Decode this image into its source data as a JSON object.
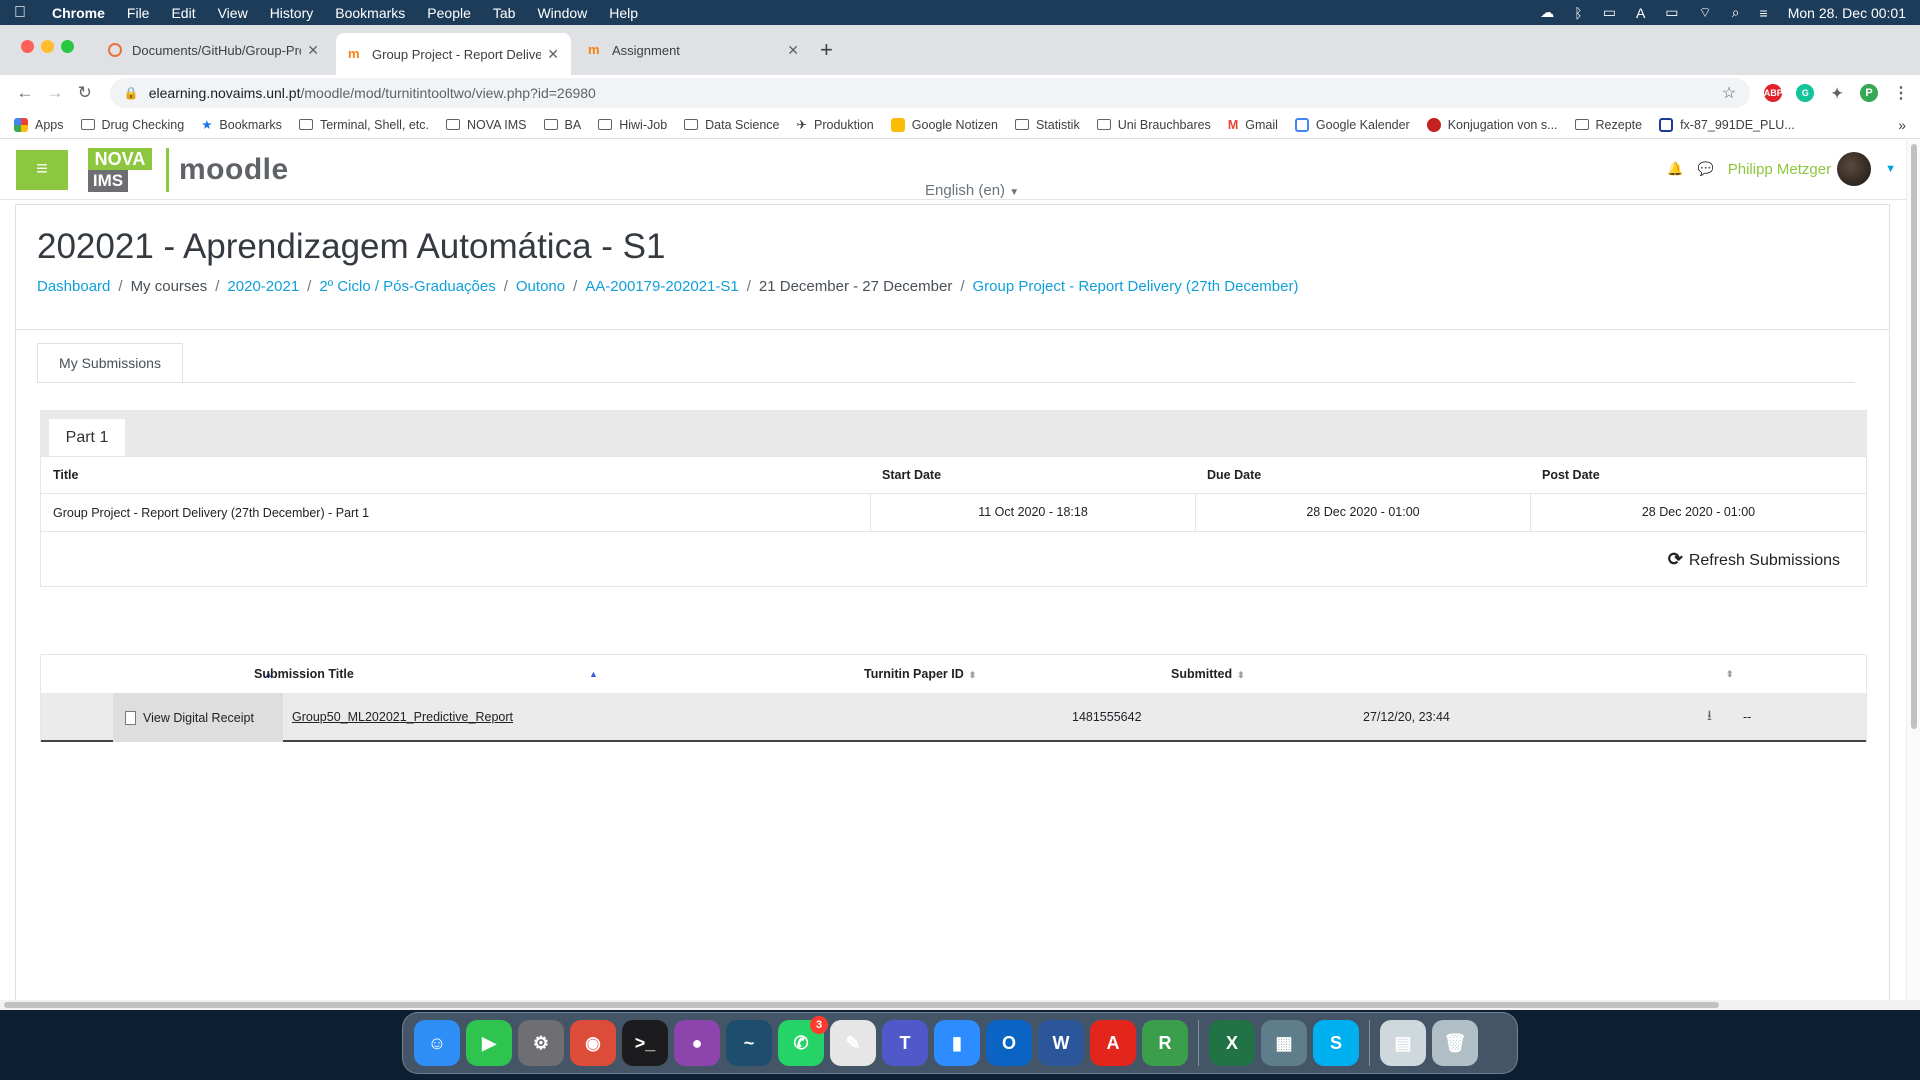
{
  "menubar": {
    "app": "Chrome",
    "menus": [
      "File",
      "Edit",
      "View",
      "History",
      "Bookmarks",
      "People",
      "Tab",
      "Window",
      "Help"
    ],
    "clock": "Mon 28. Dec  00:01"
  },
  "tabs": [
    {
      "title": "Documents/GitHub/Group-Proj",
      "active": false
    },
    {
      "title": "Group Project - Report Delivery",
      "active": true
    },
    {
      "title": "Assignment",
      "active": false
    }
  ],
  "address": {
    "host": "elearning.novaims.unl.pt",
    "path": "/moodle/mod/turnitintooltwo/view.php?id=26980"
  },
  "extensions": [
    {
      "label": "ABP",
      "color": "#e0222b"
    },
    {
      "label": "G",
      "color": "#15c39a"
    },
    {
      "label": "✦",
      "color": "#5f6368"
    },
    {
      "label": "P",
      "color": "#34a853"
    }
  ],
  "bookmarks": [
    "Apps",
    "Drug Checking",
    "Bookmarks",
    "Terminal, Shell, etc.",
    "NOVA IMS",
    "BA",
    "Hiwi-Job",
    "Data Science",
    "Produktion",
    "Google Notizen",
    "Statistik",
    "Uni Brauchbares",
    "Gmail",
    "Google Kalender",
    "Konjugation von s...",
    "Rezepte",
    "fx-87_991DE_PLU..."
  ],
  "moodle_nav": {
    "logo_top": "NOVA",
    "logo_bottom": "IMS",
    "brand": "moodle",
    "language": "English (en)",
    "user": "Philipp Metzger"
  },
  "course": {
    "title": "202021 - Aprendizagem Automática - S1",
    "breadcrumb": [
      {
        "label": "Dashboard",
        "link": true
      },
      {
        "label": "My courses",
        "link": false
      },
      {
        "label": "2020-2021",
        "link": true
      },
      {
        "label": "2º Ciclo / Pós-Graduações",
        "link": true
      },
      {
        "label": "Outono",
        "link": true
      },
      {
        "label": "AA-200179-202021-S1",
        "link": true
      },
      {
        "label": "21 December - 27 December",
        "link": false
      },
      {
        "label": "Group Project - Report Delivery (27th December)",
        "link": true
      }
    ]
  },
  "tab_label": "My Submissions",
  "part_label": "Part 1",
  "info_table": {
    "headers": [
      "Title",
      "Start Date",
      "Due Date",
      "Post Date"
    ],
    "row": [
      "Group Project - Report Delivery (27th December) - Part 1",
      "11 Oct 2020 - 18:18",
      "28 Dec 2020 - 01:00",
      "28 Dec 2020 - 01:00"
    ],
    "refresh_label": "Refresh Submissions"
  },
  "submissions_table": {
    "headers": [
      "Submission Title",
      "Turnitin Paper ID",
      "Submitted"
    ],
    "row": {
      "receipt": "View Digital Receipt",
      "title": "Group50_ML202021_Predictive_Report",
      "paper_id": "1481555642",
      "submitted": "27/12/20, 23:44",
      "grade": "--"
    }
  },
  "dock": [
    {
      "name": "finder",
      "label": "☺",
      "color": "#2f8ef5"
    },
    {
      "name": "facetime",
      "label": "▶",
      "color": "#2fc34f"
    },
    {
      "name": "system-preferences",
      "label": "⚙",
      "color": "#6e6e73"
    },
    {
      "name": "chrome",
      "label": "◉",
      "color": "#dd4b39"
    },
    {
      "name": "terminal",
      "label": ">_",
      "color": "#1c1c1e"
    },
    {
      "name": "github-desktop",
      "label": "●",
      "color": "#8e44ad"
    },
    {
      "name": "mysql-workbench",
      "label": "~",
      "color": "#1d4e6e"
    },
    {
      "name": "whatsapp",
      "label": "✆",
      "color": "#25d366",
      "badge": "3"
    },
    {
      "name": "textedit",
      "label": "✎",
      "color": "#e6e6e6"
    },
    {
      "name": "teams",
      "label": "T",
      "color": "#5059c9"
    },
    {
      "name": "zoom",
      "label": "▮",
      "color": "#2d8cff"
    },
    {
      "name": "outlook",
      "label": "O",
      "color": "#0a64c4"
    },
    {
      "name": "word",
      "label": "W",
      "color": "#2b579a"
    },
    {
      "name": "acrobat",
      "label": "A",
      "color": "#e3251c"
    },
    {
      "name": "rstudio",
      "label": "R",
      "color": "#3b9e4d"
    },
    {
      "name": "sep1",
      "sep": true
    },
    {
      "name": "excel",
      "label": "X",
      "color": "#217346"
    },
    {
      "name": "preview",
      "label": "▦",
      "color": "#607d8b"
    },
    {
      "name": "skype",
      "label": "S",
      "color": "#00aff0"
    },
    {
      "name": "sep2",
      "sep": true
    },
    {
      "name": "document",
      "label": "▤",
      "color": "#cfd8dc"
    },
    {
      "name": "trash",
      "label": "🗑",
      "color": "#b0bec5"
    }
  ]
}
